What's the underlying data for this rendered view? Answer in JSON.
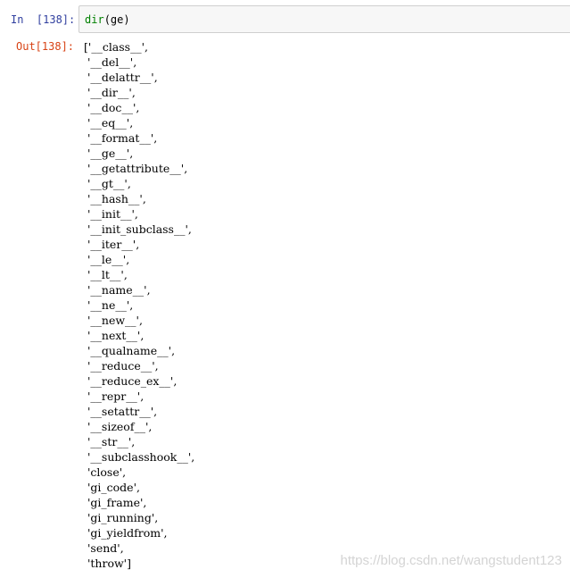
{
  "input_cell": {
    "prompt": "In  [138]:",
    "code_func": "dir",
    "code_args": "(ge)"
  },
  "output_cell": {
    "prompt": "Out[138]:",
    "lines": [
      "['__class__',",
      " '__del__',",
      " '__delattr__',",
      " '__dir__',",
      " '__doc__',",
      " '__eq__',",
      " '__format__',",
      " '__ge__',",
      " '__getattribute__',",
      " '__gt__',",
      " '__hash__',",
      " '__init__',",
      " '__init_subclass__',",
      " '__iter__',",
      " '__le__',",
      " '__lt__',",
      " '__name__',",
      " '__ne__',",
      " '__new__',",
      " '__next__',",
      " '__qualname__',",
      " '__reduce__',",
      " '__reduce_ex__',",
      " '__repr__',",
      " '__setattr__',",
      " '__sizeof__',",
      " '__str__',",
      " '__subclasshook__',",
      " 'close',",
      " 'gi_code',",
      " 'gi_frame',",
      " 'gi_running',",
      " 'gi_yieldfrom',",
      " 'send',",
      " 'throw']"
    ]
  },
  "watermark": "https://blog.csdn.net/wangstudent123",
  "colors": {
    "in_prompt": "#303f9f",
    "out_prompt": "#d84315",
    "builtin": "#008000",
    "input_bg": "#f7f7f7",
    "input_border": "#cfcfcf"
  }
}
